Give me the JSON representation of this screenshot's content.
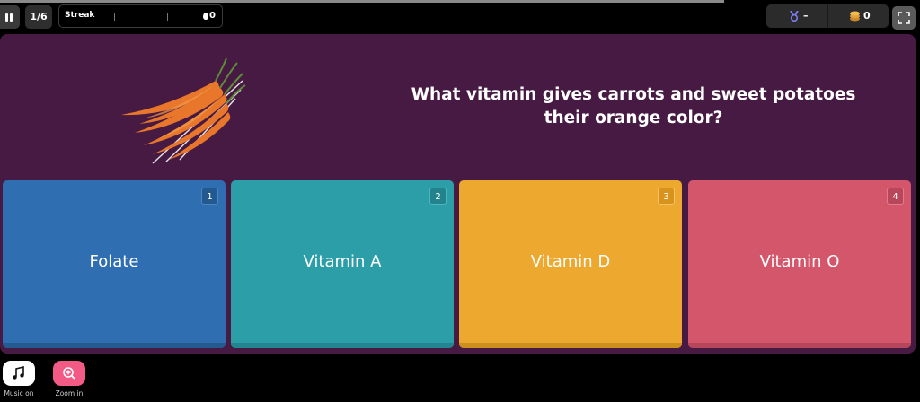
{
  "topbar": {
    "question_counter": "1/6",
    "streak_label": "Streak",
    "streak_count": "0",
    "medal_value": "–",
    "coin_value": "0"
  },
  "question": {
    "text": "What vitamin gives carrots and sweet potatoes their orange color?",
    "image_icon": "carrots-image"
  },
  "options": [
    {
      "number": "1",
      "label": "Folate",
      "color": "#2f6eb0"
    },
    {
      "number": "2",
      "label": "Vitamin A",
      "color": "#2c9ea8"
    },
    {
      "number": "3",
      "label": "Vitamin D",
      "color": "#eca82f"
    },
    {
      "number": "4",
      "label": "Vitamin O",
      "color": "#d4566b"
    }
  ],
  "bottom": {
    "music_label": "Music on",
    "zoom_label": "Zoom in"
  },
  "colors": {
    "background": "#000000",
    "question_panel": "#461a42",
    "zoom_button": "#f35b86"
  }
}
